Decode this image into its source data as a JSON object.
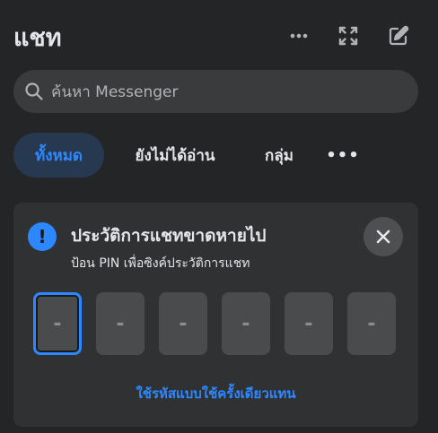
{
  "header": {
    "title": "แชท",
    "more_icon": "more-horizontal-icon",
    "expand_icon": "expand-icon",
    "compose_icon": "new-message-icon"
  },
  "search": {
    "placeholder": "ค้นหา Messenger",
    "icon": "search-icon"
  },
  "tabs": [
    {
      "label": "ทั้งหมด",
      "active": true
    },
    {
      "label": "ยังไม่ได้อ่าน",
      "active": false
    },
    {
      "label": "กลุ่ม",
      "active": false
    },
    {
      "label": "•••",
      "active": false
    }
  ],
  "card": {
    "alert_icon_glyph": "!",
    "title": "ประวัติการแชทขาดหายไป",
    "subtitle": "ป้อน PIN เพื่อซิงค์ประวัติการแชท",
    "pin_boxes": [
      "-",
      "-",
      "-",
      "-",
      "-",
      "-"
    ],
    "link": "ใช้รหัสแบบใช้ครั้งเดียวแทน"
  },
  "colors": {
    "background": "#242526",
    "accent": "#2d88ff",
    "surface": "#303133"
  }
}
